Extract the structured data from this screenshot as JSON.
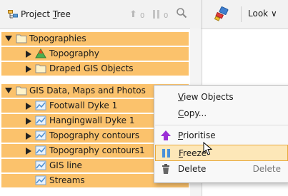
{
  "tree_header": {
    "title": "Project Tree",
    "title_underline": "T",
    "up_count": "0",
    "pause_count": "0"
  },
  "toolbar": {
    "look_label": "Look"
  },
  "tree": {
    "rows": [
      {
        "label": "Topographies"
      },
      {
        "label": "Topography"
      },
      {
        "label": "Draped GIS Objects"
      },
      {
        "label": "GIS Data, Maps and Photos"
      },
      {
        "label": "Footwall Dyke 1"
      },
      {
        "label": "Hangingwall Dyke 1"
      },
      {
        "label": "Topography contours"
      },
      {
        "label": "Topography contours1"
      },
      {
        "label": "GIS line"
      },
      {
        "label": "Streams"
      }
    ]
  },
  "context_menu": {
    "view_objects": {
      "first": "V",
      "rest": "iew Objects"
    },
    "copy": {
      "first": "C",
      "rest": "opy..."
    },
    "prioritise": {
      "first": "P",
      "rest": "rioritise"
    },
    "freeze": {
      "first": "F",
      "rest": "reeze"
    },
    "delete": {
      "label": "Delete",
      "shortcut": "Delete"
    }
  },
  "colors": {
    "selection": "#fbc26c",
    "accent_purple": "#9b2fd6",
    "freeze_blue": "#4a90d9"
  }
}
